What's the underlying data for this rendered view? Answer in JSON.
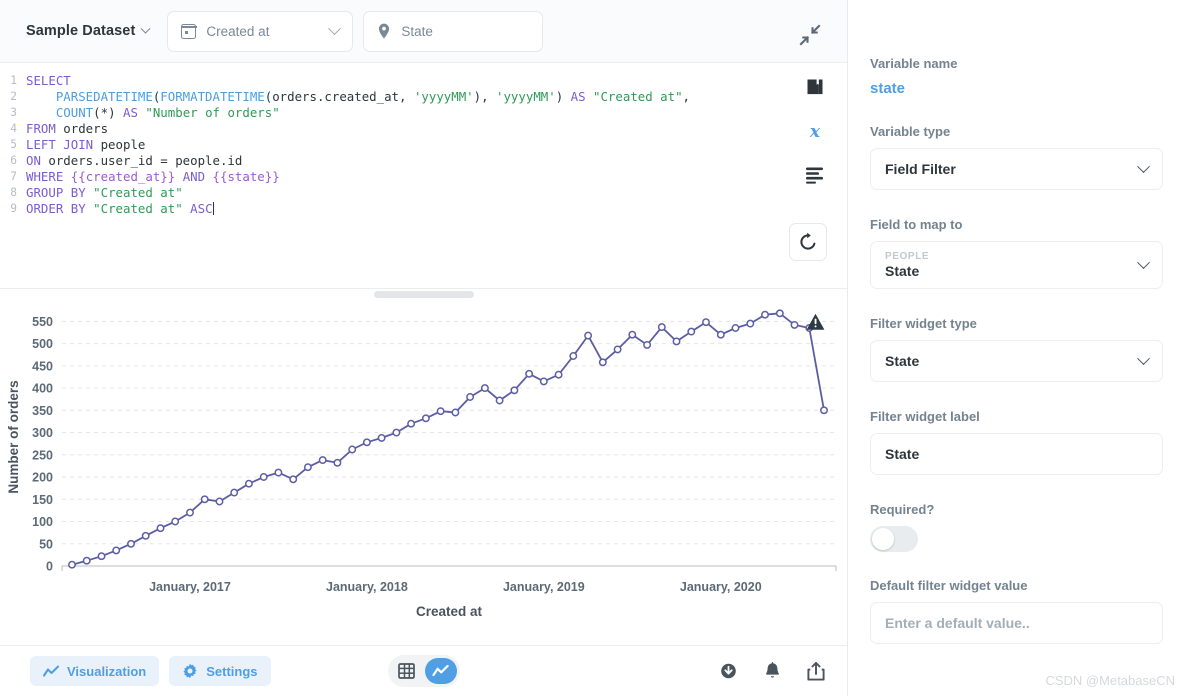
{
  "topbar": {
    "dataset_label": "Sample Dataset",
    "dataset_chevron_icon": "chevron-down-icon",
    "filters": [
      {
        "icon": "calendar-icon",
        "label": "Created at",
        "has_chevron": true
      },
      {
        "icon": "map-pin-icon",
        "label": "State",
        "has_chevron": false
      }
    ],
    "collapse_icon": "contract-arrows-icon"
  },
  "editor": {
    "line_numbers": [
      "1",
      "2",
      "3",
      "4",
      "5",
      "6",
      "7",
      "8",
      "9"
    ],
    "lines": [
      "SELECT",
      "    PARSEDATETIME(FORMATDATETIME(orders.created_at, 'yyyyMM'), 'yyyyMM') AS \"Created at\",",
      "    COUNT(*) AS \"Number of orders\"",
      "FROM orders",
      "LEFT JOIN people",
      "ON orders.user_id = people.id",
      "WHERE {{created_at}} AND {{state}}",
      "GROUP BY \"Created at\"",
      "ORDER BY \"Created at\" ASC"
    ],
    "tools": [
      {
        "name": "snippet-book-icon",
        "title": "SQL Snippets"
      },
      {
        "name": "variables-x-icon",
        "title": "Variables"
      },
      {
        "name": "format-lines-icon",
        "title": "Format"
      }
    ],
    "run_button_icon": "refresh-run-icon",
    "drag_handle_name": "editor-resize-handle"
  },
  "chart_data": {
    "type": "line",
    "title": "",
    "xlabel": "Created at",
    "ylabel": "Number of orders",
    "ylim": [
      0,
      580
    ],
    "yticks": [
      0,
      50,
      100,
      150,
      200,
      250,
      300,
      350,
      400,
      450,
      500,
      550
    ],
    "xticks": [
      "January, 2017",
      "January, 2018",
      "January, 2019",
      "January, 2020"
    ],
    "grid": true,
    "legend": "none",
    "line_color": "#5b5ea3",
    "marker": "open-circle",
    "series": [
      {
        "name": "Number of orders",
        "x": [
          "2016-05",
          "2016-06",
          "2016-07",
          "2016-08",
          "2016-09",
          "2016-10",
          "2016-11",
          "2016-12",
          "2017-01",
          "2017-02",
          "2017-03",
          "2017-04",
          "2017-05",
          "2017-06",
          "2017-07",
          "2017-08",
          "2017-09",
          "2017-10",
          "2017-11",
          "2017-12",
          "2018-01",
          "2018-02",
          "2018-03",
          "2018-04",
          "2018-05",
          "2018-06",
          "2018-07",
          "2018-08",
          "2018-09",
          "2018-10",
          "2018-11",
          "2018-12",
          "2019-01",
          "2019-02",
          "2019-03",
          "2019-04",
          "2019-05",
          "2019-06",
          "2019-07",
          "2019-08",
          "2019-09",
          "2019-10",
          "2019-11",
          "2019-12",
          "2020-01",
          "2020-02",
          "2020-03",
          "2020-04"
        ],
        "values": [
          3,
          12,
          22,
          35,
          50,
          68,
          85,
          100,
          120,
          150,
          145,
          165,
          185,
          200,
          210,
          195,
          222,
          238,
          232,
          262,
          278,
          288,
          300,
          320,
          332,
          348,
          345,
          380,
          400,
          372,
          395,
          432,
          415,
          430,
          472,
          518,
          458,
          487,
          520,
          497,
          537,
          505,
          527,
          548,
          520,
          535,
          545,
          565
        ],
        "last_points": [
          568,
          542,
          535,
          350
        ]
      }
    ]
  },
  "chart": {
    "warning_icon": "warning-triangle-icon"
  },
  "bottombar": {
    "visualization_button": {
      "icon": "line-chart-icon",
      "label": "Visualization"
    },
    "settings_button": {
      "icon": "gear-icon",
      "label": "Settings"
    },
    "view_toggle": [
      {
        "icon": "table-icon",
        "name": "table-view",
        "active": false
      },
      {
        "icon": "line-chart-icon",
        "name": "chart-view",
        "active": true
      }
    ],
    "right_icons": [
      {
        "name": "download-icon"
      },
      {
        "name": "bell-alert-icon"
      },
      {
        "name": "share-upload-icon"
      }
    ]
  },
  "sidebar": {
    "variable_name_label": "Variable name",
    "variable_name_value": "state",
    "variable_type_label": "Variable type",
    "variable_type_value": "Field Filter",
    "field_map_label": "Field to map to",
    "field_map_table": "PEOPLE",
    "field_map_value": "State",
    "widget_type_label": "Filter widget type",
    "widget_type_value": "State",
    "widget_label_label": "Filter widget label",
    "widget_label_value": "State",
    "required_label": "Required?",
    "required_on": false,
    "default_value_label": "Default filter widget value",
    "default_value_placeholder": "Enter a default value.."
  },
  "watermark": "CSDN @MetabaseCN",
  "colors": {
    "accent_blue": "#509ee3",
    "line_purple": "#5b5ea3",
    "text_dark": "#2e353b",
    "text_muted": "#74838f"
  }
}
